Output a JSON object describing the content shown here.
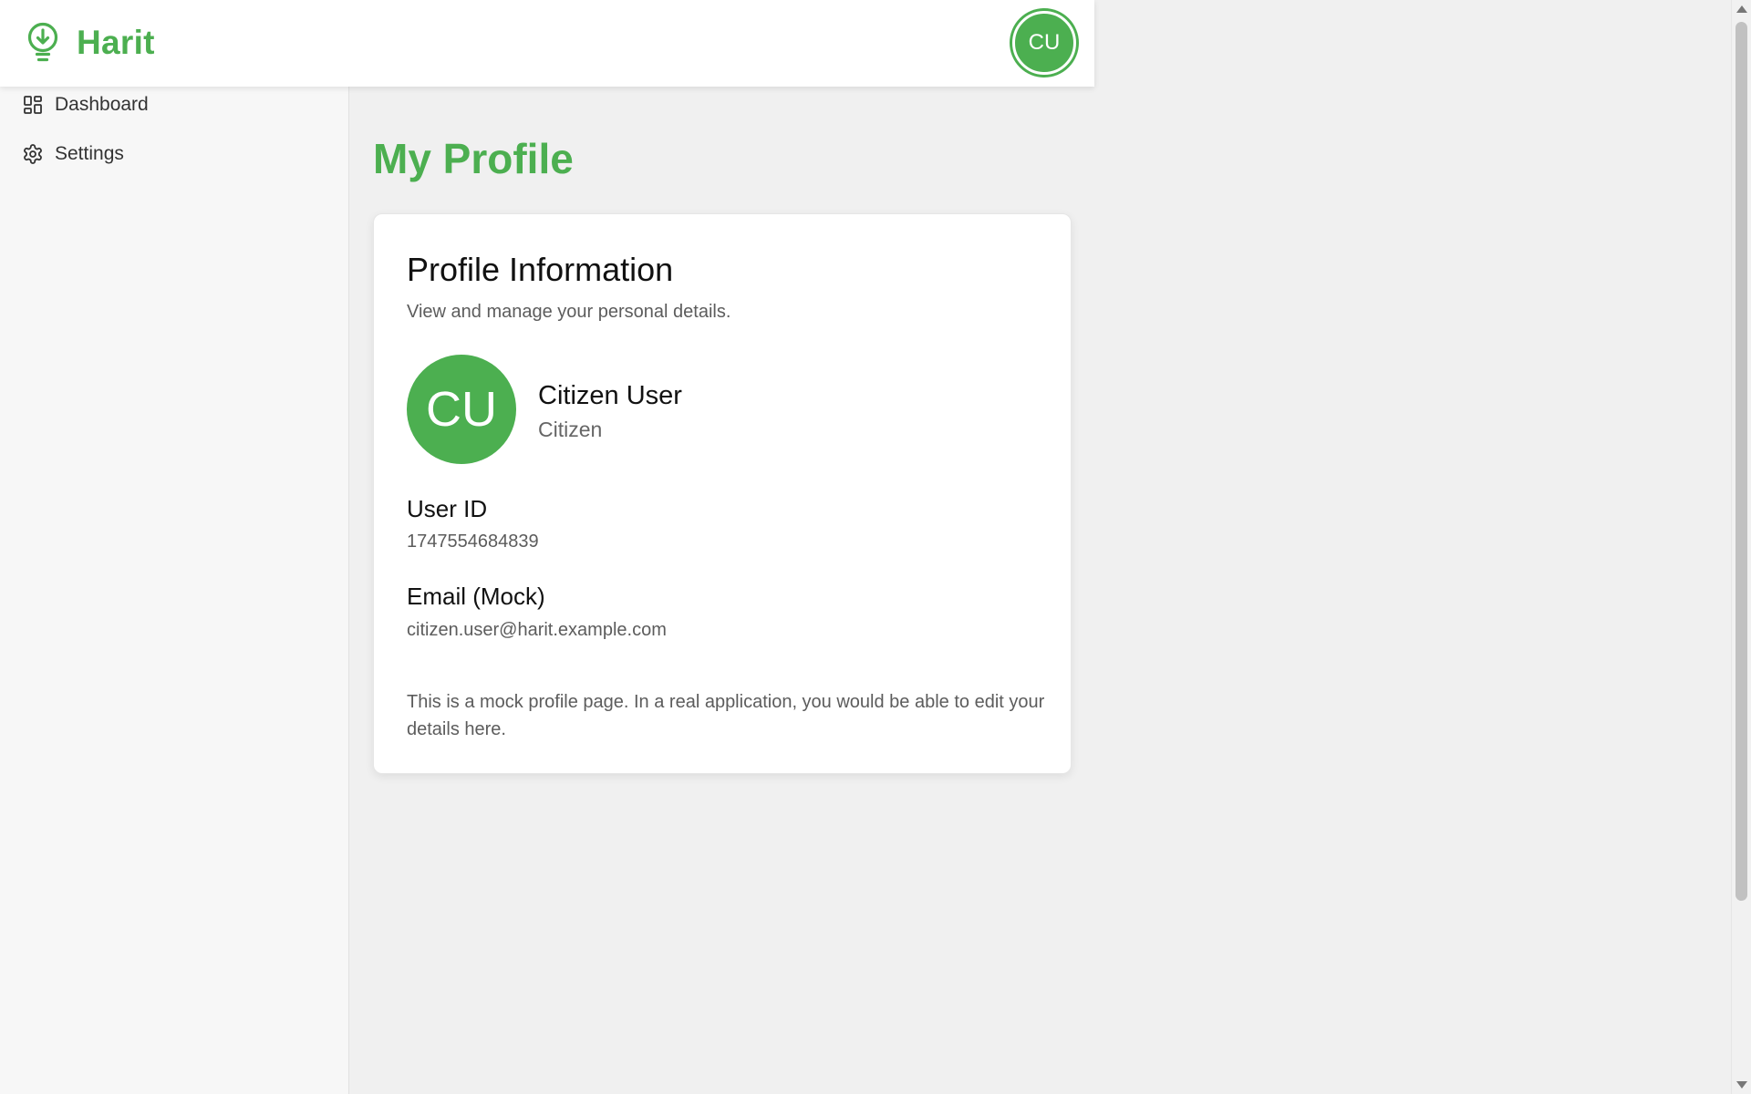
{
  "app": {
    "name": "Harit",
    "brand_color": "#4caf50",
    "logo_icon": "lightbulb-leaf-icon"
  },
  "header": {
    "avatar_initials": "CU"
  },
  "sidebar": {
    "items": [
      {
        "label": "Dashboard",
        "icon": "grid-icon"
      },
      {
        "label": "Settings",
        "icon": "gear-icon"
      }
    ]
  },
  "page": {
    "title": "My Profile"
  },
  "profile_card": {
    "title": "Profile Information",
    "subtitle": "View and manage your personal details.",
    "avatar_initials": "CU",
    "name": "Citizen User",
    "role": "Citizen",
    "user_id_label": "User ID",
    "user_id_value": "1747554684839",
    "email_label": "Email (Mock)",
    "email_value": "citizen.user@harit.example.com",
    "note": "This is a mock profile page. In a real application, you would be able to edit your details here."
  }
}
